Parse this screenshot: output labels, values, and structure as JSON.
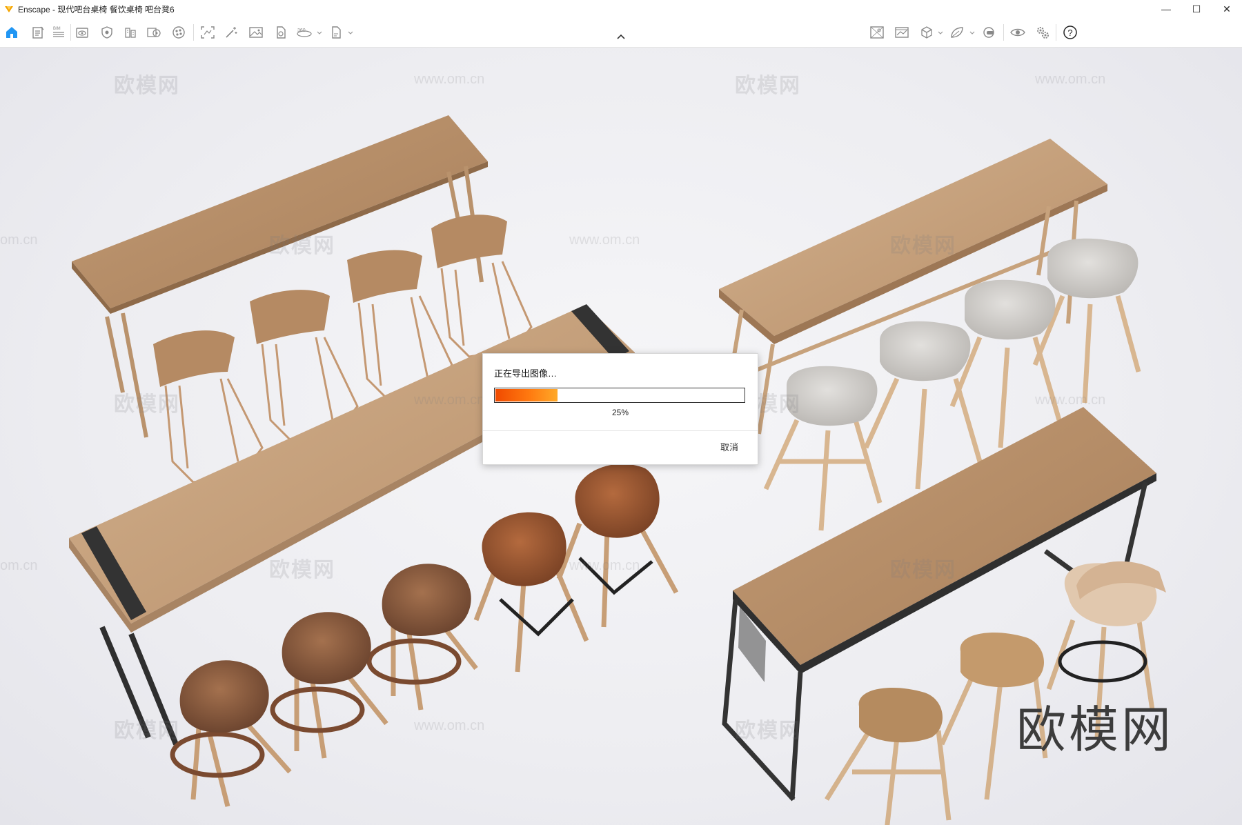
{
  "window": {
    "title": "Enscape - 现代吧台桌椅 餐饮桌椅 吧台凳6",
    "minimize_symbol": "—",
    "maximize_symbol": "☐",
    "close_symbol": "✕"
  },
  "toolbar": {
    "left_icons": [
      "home-icon",
      "document-icon",
      "bim-icon",
      "view-icon",
      "asset-shield-icon",
      "library-icon",
      "render-settings-icon",
      "material-icon",
      "screenshot-icon",
      "magic-icon",
      "image-icon",
      "export-icon",
      "panorama-360-icon",
      "export-file-icon"
    ],
    "right_icons": [
      "capture-icon",
      "gallery-icon",
      "cube-icon",
      "leaf-icon",
      "vr-headset-icon",
      "eye-icon",
      "settings-icon",
      "help-icon"
    ]
  },
  "viewport": {
    "watermark_text": "欧模网",
    "watermark_url": "www.om.cn",
    "watermark_url_partial": "om.cn",
    "brand_mark": "欧模网"
  },
  "dialog": {
    "title": "正在导出图像…",
    "progress": 0.25,
    "progress_label": "25%",
    "cancel_label": "取消",
    "accent_color": "#ff7a10"
  }
}
